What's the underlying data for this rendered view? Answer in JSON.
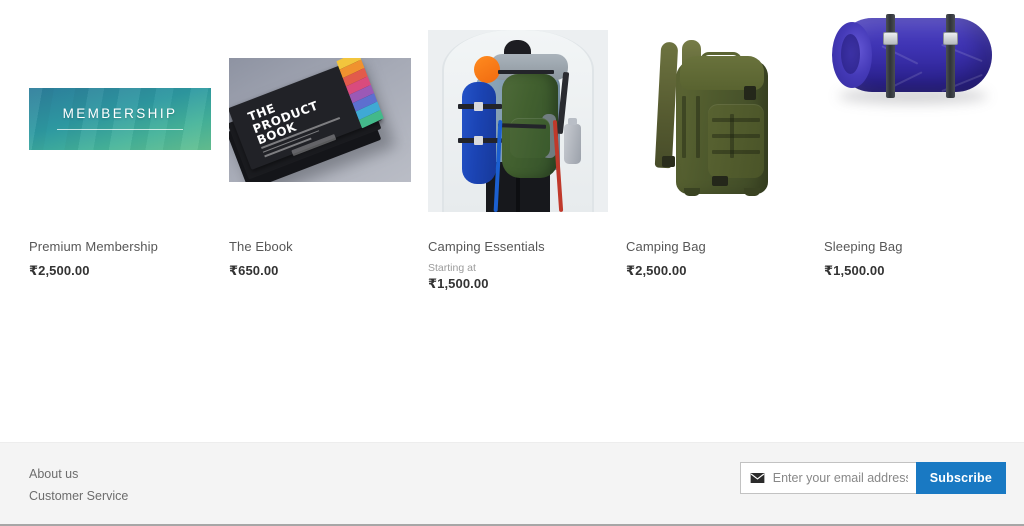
{
  "products": [
    {
      "name": "Premium Membership",
      "price": "₹2,500.00",
      "starting_at_label": null,
      "image_alt": "membership-banner",
      "banner_text": "MEMBERSHIP"
    },
    {
      "name": "The Ebook",
      "price": "₹650.00",
      "starting_at_label": null,
      "image_alt": "product-book-cover",
      "book_title": "THE PRODUCT BOOK"
    },
    {
      "name": "Camping Essentials",
      "price": "₹1,500.00",
      "starting_at_label": "Starting at",
      "image_alt": "hiker-with-backpack"
    },
    {
      "name": "Camping Bag",
      "price": "₹2,500.00",
      "starting_at_label": null,
      "image_alt": "olive-tactical-backpack"
    },
    {
      "name": "Sleeping Bag",
      "price": "₹1,500.00",
      "starting_at_label": null,
      "image_alt": "blue-rolled-sleeping-bag"
    }
  ],
  "footer": {
    "links": [
      {
        "label": "About us"
      },
      {
        "label": "Customer Service"
      }
    ],
    "newsletter": {
      "placeholder": "Enter your email address",
      "submit_label": "Subscribe",
      "icon": "envelope-icon"
    }
  },
  "colors": {
    "accent_blue": "#1979c3",
    "footer_bg": "#f4f4f4",
    "text_primary": "#333333",
    "text_muted": "#6d6d6d",
    "price_muted": "#9b9b9b"
  }
}
